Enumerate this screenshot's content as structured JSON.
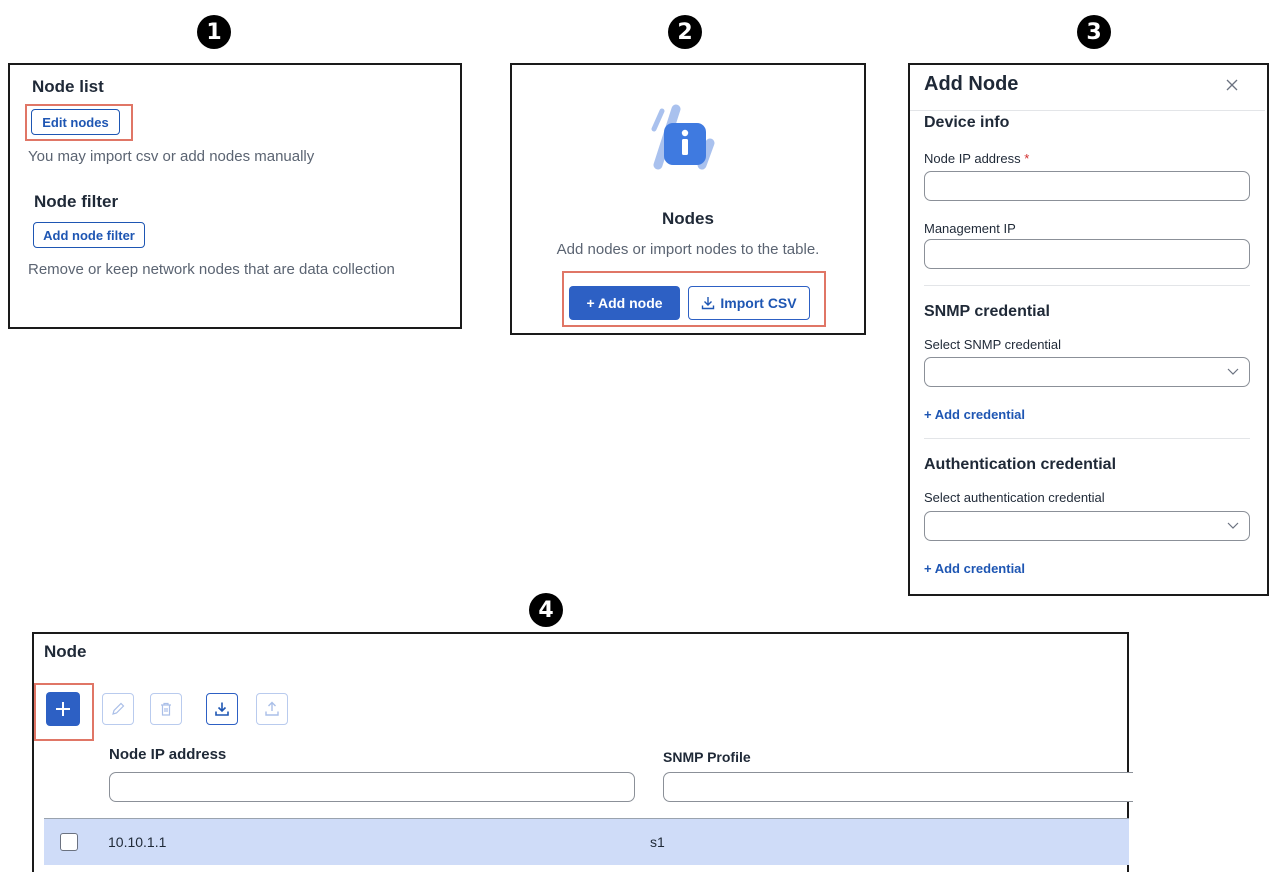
{
  "steps": [
    "1",
    "2",
    "3",
    "4"
  ],
  "panel1": {
    "node_list_title": "Node list",
    "edit_nodes_label": "Edit nodes",
    "import_hint": "You may import csv or add nodes manually",
    "node_filter_title": "Node filter",
    "add_filter_label": "Add node filter",
    "filter_hint": "Remove or keep network nodes that are data collection"
  },
  "panel2": {
    "icon": "info-icon",
    "title": "Nodes",
    "description": "Add nodes or import nodes to the table.",
    "add_node_label": "+ Add node",
    "import_csv_label": "Import CSV"
  },
  "panel3": {
    "title": "Add Node",
    "close_icon": "close-icon",
    "device_info_title": "Device info",
    "node_ip_label": "Node IP address",
    "required_marker": "*",
    "node_ip_value": "",
    "management_ip_label": "Management IP",
    "management_ip_value": "",
    "snmp_title": "SNMP credential",
    "snmp_select_label": "Select SNMP credential",
    "snmp_selected": "",
    "snmp_add_label": "+ Add credential",
    "auth_title": "Authentication credential",
    "auth_select_label": "Select authentication credential",
    "auth_selected": "",
    "auth_add_label": "+ Add credential"
  },
  "panel4": {
    "title": "Node",
    "toolbar": [
      "plus-icon",
      "pencil-icon",
      "trash-icon",
      "download-icon",
      "upload-icon"
    ],
    "columns": [
      "Node IP address",
      "SNMP Profile"
    ],
    "filters": [
      "",
      ""
    ],
    "rows": [
      {
        "node_ip": "10.10.1.1",
        "snmp_profile": "s1",
        "checked": false
      }
    ]
  },
  "colors": {
    "primary": "#2d60c4",
    "highlight": "#e07666",
    "row_selected": "#cfdcf8",
    "required": "#d12c2c"
  }
}
